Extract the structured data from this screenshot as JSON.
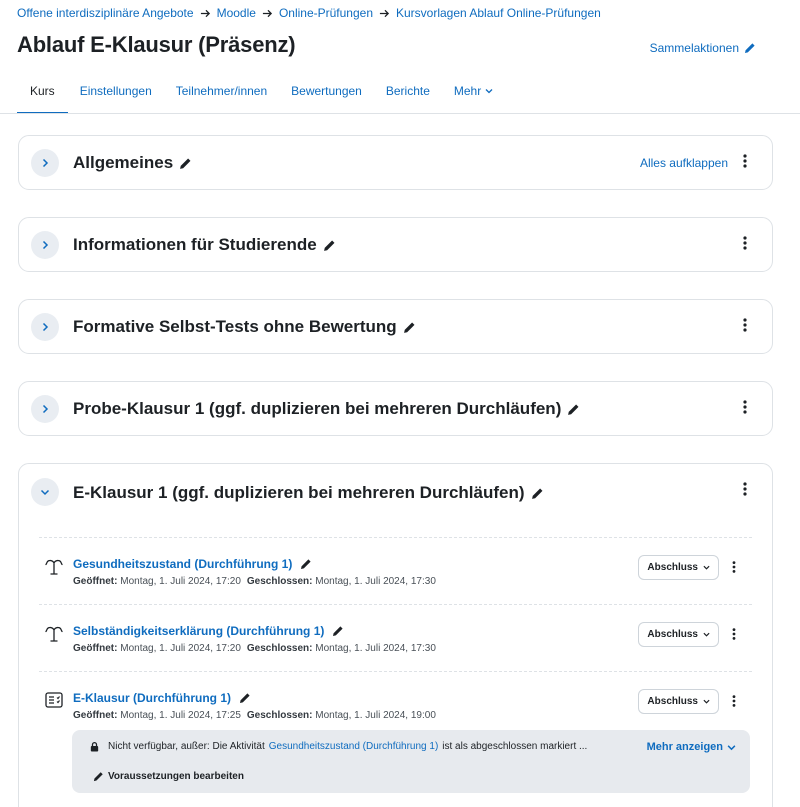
{
  "breadcrumb": [
    "Offene interdisziplinäre Angebote",
    "Moodle",
    "Online-Prüfungen",
    "Kursvorlagen Ablauf Online-Prüfungen"
  ],
  "page_title": "Ablauf E-Klausur (Präsenz)",
  "bulk_actions_label": "Sammelaktionen",
  "tabs": [
    {
      "label": "Kurs",
      "active": true
    },
    {
      "label": "Einstellungen"
    },
    {
      "label": "Teilnehmer/innen"
    },
    {
      "label": "Bewertungen"
    },
    {
      "label": "Berichte"
    },
    {
      "label": "Mehr"
    }
  ],
  "expand_all_label": "Alles aufklappen",
  "sections": [
    {
      "title": "Allgemeines",
      "collapsed": true
    },
    {
      "title": "Informationen für Studierende",
      "collapsed": true
    },
    {
      "title": "Formative Selbst-Tests ohne Bewertung",
      "collapsed": true
    },
    {
      "title": "Probe-Klausur 1 (ggf. duplizieren bei mehreren Durchläufen)",
      "collapsed": true
    },
    {
      "title": "E-Klausur 1 (ggf. duplizieren bei mehreren Durchläufen)",
      "collapsed": false
    }
  ],
  "activities": [
    {
      "icon": "feedback-icon",
      "name": "Gesundheitszustand (Durchführung 1)",
      "opened_label": "Geöffnet:",
      "opened": "Montag, 1. Juli 2024, 17:20",
      "closed_label": "Geschlossen:",
      "closed": "Montag, 1. Juli 2024, 17:30",
      "completion": "Abschluss"
    },
    {
      "icon": "feedback-icon",
      "name": "Selbständigkeitserklärung (Durchführung 1)",
      "opened_label": "Geöffnet:",
      "opened": "Montag, 1. Juli 2024, 17:20",
      "closed_label": "Geschlossen:",
      "closed": "Montag, 1. Juli 2024, 17:30",
      "completion": "Abschluss"
    },
    {
      "icon": "quiz-icon",
      "name": "E-Klausur (Durchführung 1)",
      "opened_label": "Geöffnet:",
      "opened": "Montag, 1. Juli 2024, 17:25",
      "closed_label": "Geschlossen:",
      "closed": "Montag, 1. Juli 2024, 19:00",
      "completion": "Abschluss"
    }
  ],
  "restriction": {
    "text_before": "Nicht verfügbar, außer: Die Aktivität",
    "link": "Gesundheitszustand (Durchführung 1)",
    "text_after": "ist als abgeschlossen markiert ...",
    "more_label": "Mehr anzeigen",
    "edit_label": "Voraussetzungen bearbeiten"
  },
  "colors": {
    "link": "#0f6cbf",
    "text": "#1d2125",
    "border": "#dee2e6",
    "restriction_bg": "#e7eaee"
  }
}
